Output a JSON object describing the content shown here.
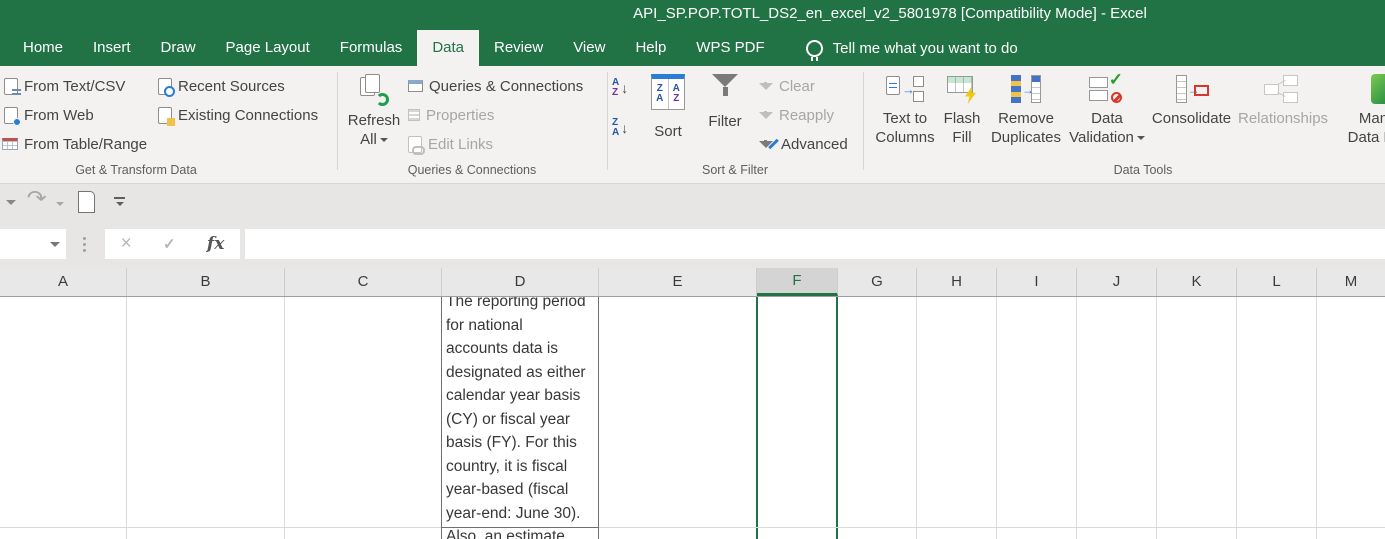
{
  "window": {
    "title": "API_SP.POP.TOTL_DS2_en_excel_v2_5801978  [Compatibility Mode]  -  Excel"
  },
  "tabs": {
    "items": [
      "Home",
      "Insert",
      "Draw",
      "Page Layout",
      "Formulas",
      "Data",
      "Review",
      "View",
      "Help",
      "WPS PDF"
    ],
    "active_tab": "Data",
    "tell_me_label": "Tell me what you want to do"
  },
  "ribbon": {
    "get_transform": {
      "group_label": "Get & Transform Data",
      "from_text_csv": "From Text/CSV",
      "from_web": "From Web",
      "from_table_range": "From Table/Range",
      "recent_sources": "Recent Sources",
      "existing_connections": "Existing Connections"
    },
    "queries": {
      "group_label": "Queries & Connections",
      "refresh_line1": "Refresh",
      "refresh_line2": "All",
      "queries_connections": "Queries & Connections",
      "properties": "Properties",
      "edit_links": "Edit Links"
    },
    "sort_filter": {
      "group_label": "Sort & Filter",
      "sort": "Sort",
      "filter": "Filter",
      "clear": "Clear",
      "reapply": "Reapply",
      "advanced": "Advanced",
      "az_letters": {
        "a": "A",
        "z": "Z"
      }
    },
    "data_tools": {
      "group_label": "Data Tools",
      "text_to_columns_line1": "Text to",
      "text_to_columns_line2": "Columns",
      "flash_fill_line1": "Flash",
      "flash_fill_line2": "Fill",
      "remove_duplicates_line1": "Remove",
      "remove_duplicates_line2": "Duplicates",
      "data_validation_line1": "Data",
      "data_validation_line2": "Validation",
      "consolidate": "Consolidate",
      "relationships": "Relationships",
      "manage_line1": "Manage",
      "manage_line2": "Data Model"
    }
  },
  "formula_bar": {
    "name_box_value": "",
    "cancel_glyph": "×",
    "enter_glyph": "✓",
    "fx_label": "fx",
    "formula_value": ""
  },
  "sheet": {
    "columns": [
      "A",
      "B",
      "C",
      "D",
      "E",
      "F",
      "G",
      "H",
      "I",
      "J",
      "K",
      "L",
      "M"
    ],
    "selected_column": "F",
    "d_cell_lines": [
      "The reporting period",
      "for national",
      "accounts data is",
      "designated as either",
      "calendar year basis",
      "(CY) or fiscal year",
      "basis (FY). For this",
      "country, it is fiscal",
      "year-based (fiscal",
      "year-end: June 30)."
    ],
    "d_next_row_text": "Also, an estimate"
  },
  "colors": {
    "excel_green": "#217346",
    "ribbon_bg": "#f3f2f1",
    "chrome_bg": "#e7e6e5",
    "disabled_text": "#a8a6a4",
    "selection_green": "#217346",
    "gridline": "#d9d9d9"
  }
}
